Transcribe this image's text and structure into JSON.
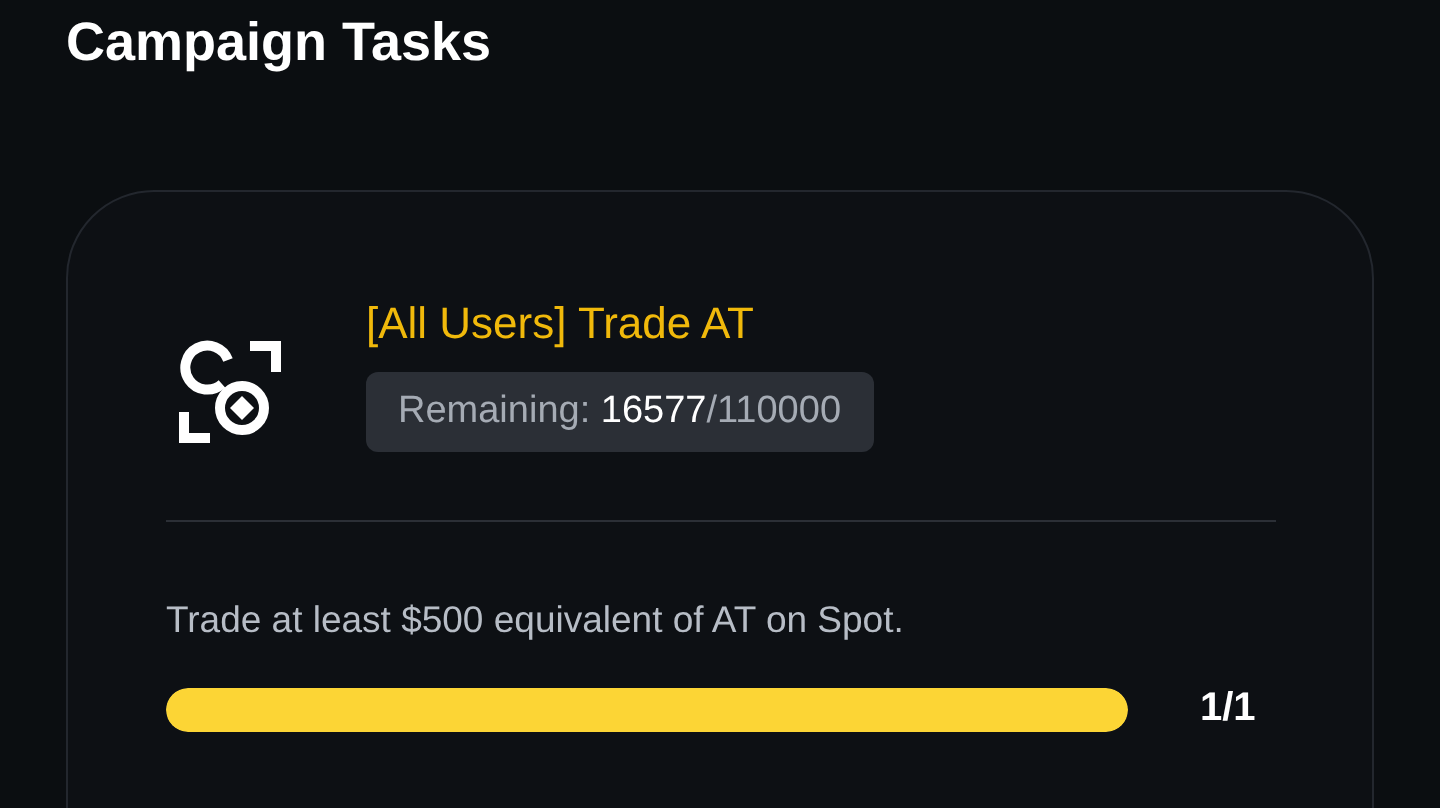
{
  "heading": "Campaign Tasks",
  "task": {
    "title": "[All Users] Trade AT",
    "remaining": "Remaining: **16577**/110000",
    "description": "Trade at least $500 equivalent of AT on Spot.",
    "level": 1,
    "progress": "1/1"
  }
}
